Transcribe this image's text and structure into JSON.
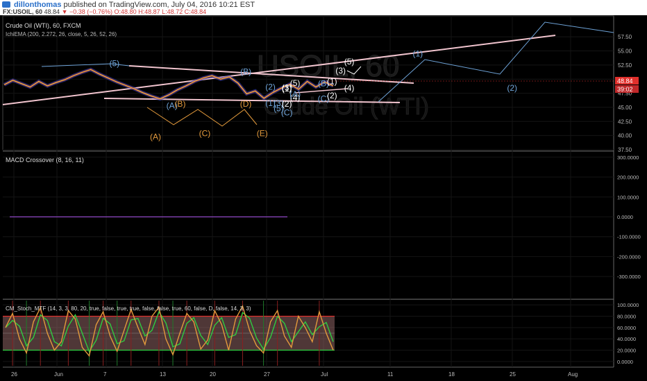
{
  "header": {
    "author": "dillonthomas",
    "published_text": "published on TradingView.com, July 04, 2016 10:21 EST",
    "symbol": "FX:USOIL, 60",
    "last": "48.84",
    "change": "▼ −0.38 (−0.76%)",
    "ohlc": "O:48.80 H:48.87 L:48.72 C:48.84"
  },
  "price_panel": {
    "title": "Crude Oil (WTI), 60, FXCM",
    "indicator": "IchiEMA (200, 2.272, 26, close, 5, 26, 52, 26)",
    "watermark_1": "USOIL, 60",
    "watermark_2": "Crude Oil (WTI)",
    "price_tag": "48.84",
    "time_tag": "39:02"
  },
  "macd_panel": {
    "title": "MACD Crossover (8, 16, 11)"
  },
  "stoch_panel": {
    "title": "CM_Stoch_MTF (14, 3, 3, 80, 20, true, false, true, true, false, false, true, 60, false, D, false, 14, 3, 3)"
  },
  "colors": {
    "up": "#2ecc40",
    "down": "#e0302c",
    "blue_wave": "#6ea3d8",
    "orange_wave": "#e39a3c",
    "trend": "#f2c5cf"
  },
  "chart_data": [
    {
      "type": "line",
      "panel": "price",
      "title": "Crude Oil (WTI), 60, FXCM",
      "x_ticks": [
        "26",
        "Jun",
        "7",
        "13",
        "20",
        "27",
        "Jul",
        "11",
        "18",
        "25",
        "Aug"
      ],
      "y_ticks": [
        "57.50",
        "55.00",
        "52.50",
        "50.00",
        "47.50",
        "45.00",
        "42.50",
        "40.00",
        "37.50"
      ],
      "ylim": [
        37.5,
        58.5
      ],
      "last_price": 48.84,
      "series": [
        {
          "values": [
            49.0,
            49.8,
            49.2,
            48.6,
            49.6,
            48.8,
            49.4,
            49.9,
            50.6,
            51.2,
            51.7,
            50.9,
            50.2,
            49.5,
            48.9,
            48.3,
            47.6,
            47.0,
            46.5,
            47.2,
            48.1,
            48.8,
            49.6,
            50.2,
            50.6,
            50.0,
            50.4,
            49.3,
            47.4,
            47.9,
            46.6,
            47.6,
            48.4,
            49.1,
            48.2,
            49.6,
            48.6,
            49.5,
            48.8
          ]
        }
      ],
      "wave_labels": [
        {
          "text": "(5)",
          "color": "blue",
          "x": "Jun 8",
          "y": 52.8
        },
        {
          "text": "(B)",
          "color": "blue",
          "x": "Jun 24",
          "y": 51.3
        },
        {
          "text": "(A)",
          "color": "blue",
          "x": "Jun 15",
          "y": 45.3
        },
        {
          "text": "(B)",
          "color": "orange",
          "x": "Jun 16",
          "y": 45.6
        },
        {
          "text": "(D)",
          "color": "orange",
          "x": "Jun 24",
          "y": 45.6
        },
        {
          "text": "(A)",
          "color": "orange",
          "x": "Jun 13",
          "y": 39.8
        },
        {
          "text": "(C)",
          "color": "orange",
          "x": "Jun 19",
          "y": 40.4
        },
        {
          "text": "(E)",
          "color": "orange",
          "x": "Jun 26",
          "y": 40.4
        },
        {
          "text": "(2)",
          "color": "blue",
          "x": "Jun 27",
          "y": 48.6
        },
        {
          "text": "(1)",
          "color": "blue",
          "x": "Jun 27",
          "y": 45.7
        },
        {
          "text": "(3)",
          "color": "blue",
          "x": "Jun 28",
          "y": 45.7
        },
        {
          "text": "(5)",
          "color": "blue",
          "x": "Jun 28",
          "y": 44.8
        },
        {
          "text": "(C)",
          "color": "blue",
          "x": "Jun 29",
          "y": 44.1
        },
        {
          "text": "(1)",
          "color": "white",
          "x": "Jun 29",
          "y": 48.3
        },
        {
          "text": "(3)",
          "color": "white",
          "x": "Jun 29",
          "y": 48.5
        },
        {
          "text": "(2)",
          "color": "white",
          "x": "Jun 29",
          "y": 45.6
        },
        {
          "text": "(4)",
          "color": "white",
          "x": "Jun 30",
          "y": 46.7
        },
        {
          "text": "(5)",
          "color": "white",
          "x": "Jun 30",
          "y": 49.3
        },
        {
          "text": "(B)",
          "color": "blue",
          "x": "Jul 1",
          "y": 49.2
        },
        {
          "text": "(A)",
          "color": "blue",
          "x": "Jun 30",
          "y": 47.3
        },
        {
          "text": "(C)",
          "color": "blue",
          "x": "Jul 1",
          "y": 46.5
        },
        {
          "text": "(1)",
          "color": "white",
          "x": "Jul 2",
          "y": 49.6
        },
        {
          "text": "(3)",
          "color": "white",
          "x": "Jul 3",
          "y": 51.5
        },
        {
          "text": "(5)",
          "color": "white",
          "x": "Jul 4",
          "y": 53.1
        },
        {
          "text": "(2)",
          "color": "white",
          "x": "Jul 2",
          "y": 47.1
        },
        {
          "text": "(4)",
          "color": "white",
          "x": "Jul 4",
          "y": 48.4
        },
        {
          "text": "(1)",
          "color": "blue",
          "x": "Jul 12",
          "y": 54.5
        },
        {
          "text": "(2)",
          "color": "blue",
          "x": "Jul 23",
          "y": 48.4
        }
      ]
    },
    {
      "type": "line",
      "panel": "macd",
      "title": "MACD Crossover (8, 16, 11)",
      "y_ticks": [
        "300.0000",
        "200.0000",
        "100.0000",
        "0.0000",
        "-100.0000",
        "-200.0000",
        "-300.0000"
      ],
      "ylim": [
        -310,
        310
      ],
      "series": [
        {
          "values": [
            0,
            0,
            0,
            0,
            0,
            0,
            0,
            0,
            0,
            0
          ]
        }
      ]
    },
    {
      "type": "line",
      "panel": "stoch",
      "title": "CM_Stoch_MTF (14, 3, 3, 80, 20, true, false, true, true, false, false, true, 60, false, D, false, 14, 3, 3)",
      "y_ticks": [
        "100.0000",
        "80.0000",
        "60.0000",
        "40.0000",
        "20.0000",
        "0.0000"
      ],
      "ylim": [
        -10,
        110
      ],
      "bands": [
        20,
        80
      ],
      "series": [
        {
          "values": [
            60,
            85,
            40,
            15,
            70,
            95,
            50,
            20,
            35,
            90,
            75,
            25,
            10,
            65,
            88,
            45,
            18,
            55,
            92,
            60,
            30,
            80,
            96,
            40,
            12,
            50,
            85,
            70,
            22,
            38,
            90,
            65,
            20,
            75,
            98,
            55,
            28,
            15,
            70,
            90,
            45,
            25,
            80,
            60,
            35,
            88,
            50,
            20
          ]
        }
      ]
    }
  ]
}
